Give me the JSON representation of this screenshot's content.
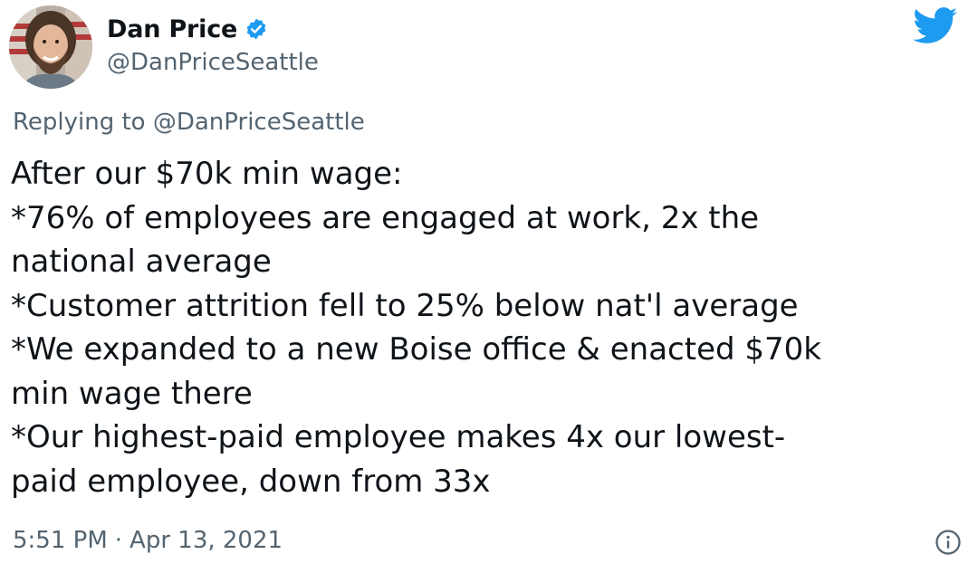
{
  "author": {
    "display_name": "Dan Price",
    "handle": "@DanPriceSeattle",
    "verified": true,
    "avatar_icon": "profile-photo"
  },
  "header": {
    "logo_icon": "twitter-bird-icon",
    "logo_color": "#1d9bf0"
  },
  "reply": {
    "text": "Replying to @DanPriceSeattle"
  },
  "body": {
    "lines": [
      "After our $70k min wage:",
      "*76% of employees are engaged at work, 2x the",
      "national average",
      "*Customer attrition fell to 25% below nat'l average",
      "*We expanded to a new Boise office & enacted $70k",
      "min wage there",
      "*Our highest-paid employee makes 4x our lowest-",
      "paid employee, down from 33x"
    ]
  },
  "footer": {
    "time": "5:51 PM",
    "separator": "·",
    "date": "Apr 13, 2021",
    "info_icon": "info-icon"
  },
  "colors": {
    "text_primary": "#0f1419",
    "text_secondary": "#536471",
    "verified_badge": "#1d9bf0"
  }
}
